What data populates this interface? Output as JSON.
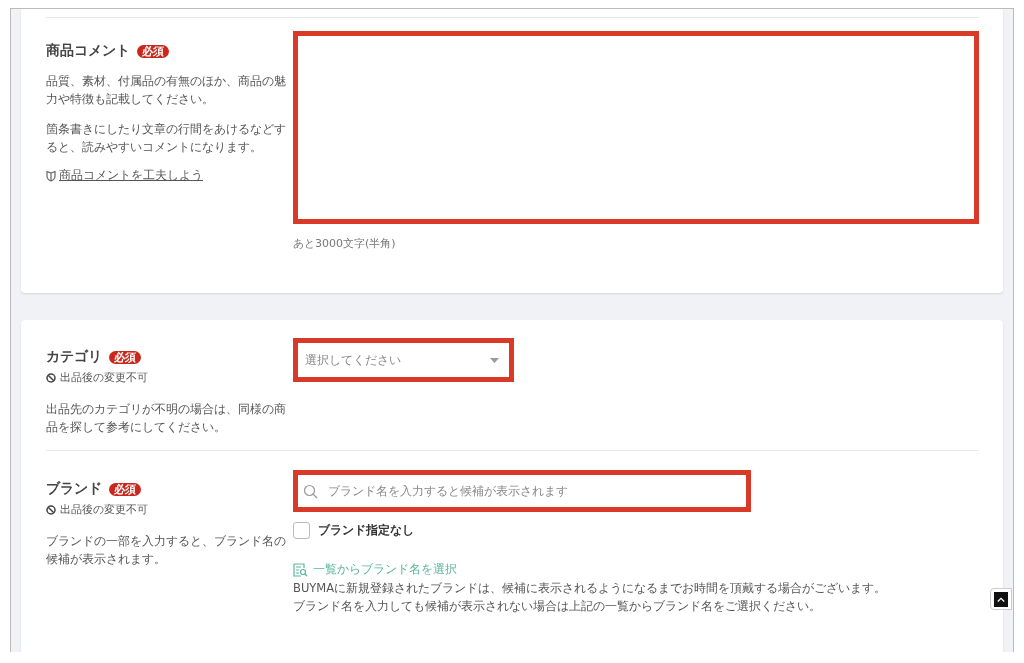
{
  "comment_section": {
    "title": "商品コメント",
    "required_badge": "必須",
    "descriptions": [
      "品質、素材、付属品の有無のほか、商品の魅力や特徴も記載してください。",
      "箇条書きにしたり文章の行間をあけるなどすると、読みやすいコメントになります。"
    ],
    "tip_link": "商品コメントを工夫しよう",
    "char_count": "あと3000文字(半角)"
  },
  "category_section": {
    "title": "カテゴリ",
    "required_badge": "必須",
    "lock_note": "出品後の変更不可",
    "description": "出品先のカテゴリが不明の場合は、同様の商品を探して参考にしてください。",
    "select": {
      "placeholder": "選択してください"
    }
  },
  "brand_section": {
    "title": "ブランド",
    "required_badge": "必須",
    "lock_note": "出品後の変更不可",
    "description": "ブランドの一部を入力すると、ブランド名の候補が表示されます。",
    "search": {
      "placeholder": "ブランド名を入力すると候補が表示されます"
    },
    "no_brand_checkbox": {
      "label": "ブランド指定なし",
      "checked": false
    },
    "list_link": "一覧からブランド名を選択",
    "notes": [
      "BUYMAに新規登録されたブランドは、候補に表示されるようになるまでお時間を頂戴する場合がございます。",
      "ブランド名を入力しても候補が表示されない場合は上記の一覧からブランド名をご選択ください。"
    ]
  }
}
